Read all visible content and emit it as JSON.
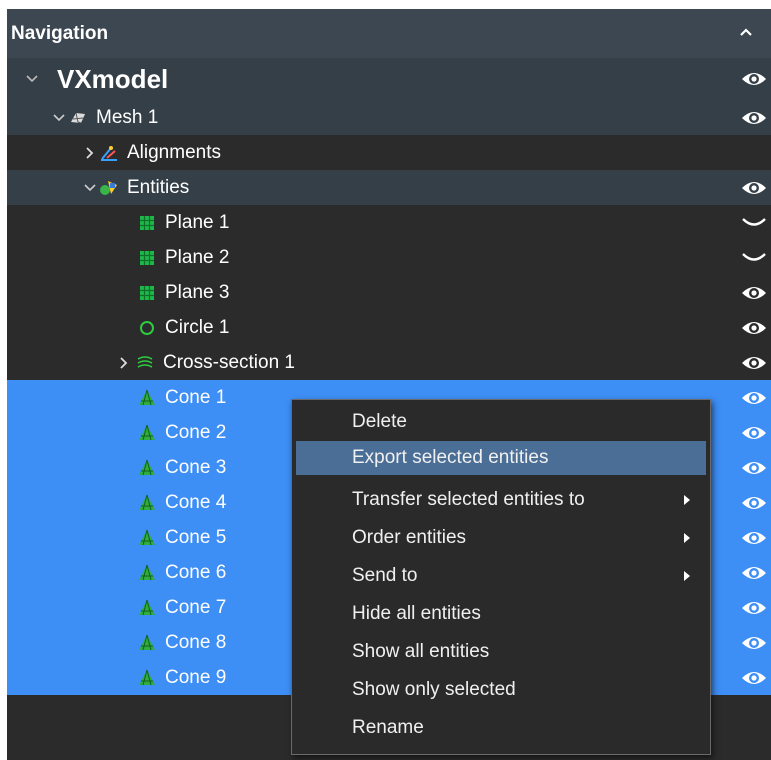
{
  "header": {
    "title": "Navigation"
  },
  "tree": {
    "root": "VXmodel",
    "mesh": "Mesh 1",
    "alignments": "Alignments",
    "entities": "Entities",
    "planes": [
      "Plane 1",
      "Plane 2",
      "Plane 3"
    ],
    "circle": "Circle 1",
    "cross_section": "Cross-section 1",
    "cones": [
      "Cone 1",
      "Cone 2",
      "Cone 3",
      "Cone 4",
      "Cone 5",
      "Cone 6",
      "Cone 7",
      "Cone 8",
      "Cone 9"
    ]
  },
  "context_menu": {
    "items": [
      "Delete",
      "Export selected entities",
      "Transfer selected entities to",
      "Order entities",
      "Send to",
      "Hide all entities",
      "Show all entities",
      "Show only selected",
      "Rename"
    ],
    "highlighted": "Export selected entities"
  },
  "colors": {
    "panel_bg": "#2b2b2b",
    "header_bg": "#3c4752",
    "row_alt_bg": "#353f48",
    "selection_bg": "#3d8ef5",
    "menu_hover_bg": "#4a6e96",
    "plane_icon": "#1db84a",
    "cone_icon": "#2eae3f"
  },
  "icons": {
    "header": "chevron-up-icon",
    "visible": "eye-icon",
    "hidden": "eye-closed-icon",
    "expanded": "chevron-down-icon",
    "collapsed": "chevron-right-icon"
  }
}
